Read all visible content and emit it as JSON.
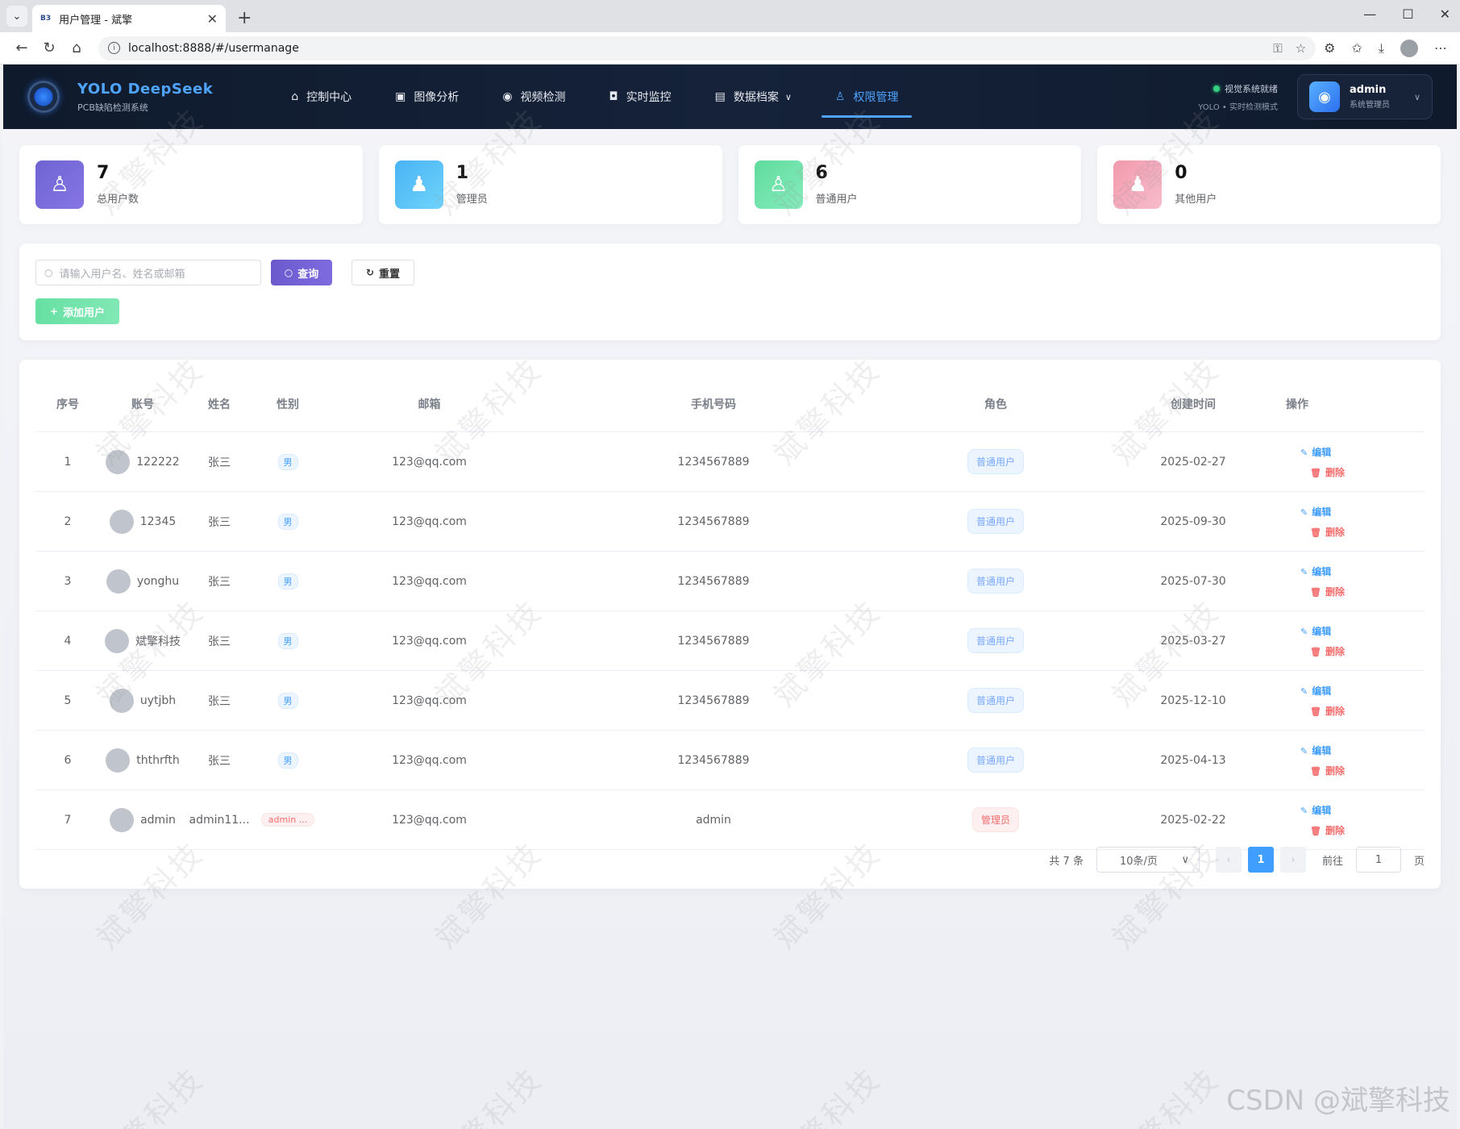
{
  "browser": {
    "tab_favicon": "B3",
    "tab_title": "用户管理 - 斌擎",
    "url": "localhost:8888/#/usermanage"
  },
  "header": {
    "brand_name": "YOLO DeepSeek",
    "brand_sub": "PCB缺陷检测系统",
    "nav": [
      {
        "label": "控制中心",
        "icon": "home-icon"
      },
      {
        "label": "图像分析",
        "icon": "image-icon"
      },
      {
        "label": "视频检测",
        "icon": "play-icon"
      },
      {
        "label": "实时监控",
        "icon": "camera-icon"
      },
      {
        "label": "数据档案",
        "icon": "document-icon"
      },
      {
        "label": "权限管理",
        "icon": "user-icon",
        "active": true
      }
    ],
    "status_text": "视觉系统就绪",
    "status_sub": "YOLO • 实时检测模式",
    "user_name": "admin",
    "user_role": "系统管理员"
  },
  "stats": [
    {
      "value": "7",
      "label": "总用户数",
      "color": "#7b6fd6"
    },
    {
      "value": "1",
      "label": "管理员",
      "color": "#4fc3f7"
    },
    {
      "value": "6",
      "label": "普通用户",
      "color": "#69e3a8"
    },
    {
      "value": "0",
      "label": "其他用户",
      "color": "#f4a7b5"
    }
  ],
  "search": {
    "placeholder": "请输入用户名、姓名或邮箱",
    "query_label": "查询",
    "reset_label": "重置",
    "add_label": "添加用户"
  },
  "table": {
    "headers": [
      "序号",
      "账号",
      "姓名",
      "性别",
      "邮箱",
      "手机号码",
      "角色",
      "创建时间",
      "操作"
    ],
    "edit_label": "编辑",
    "delete_label": "删除",
    "rows": [
      {
        "no": "1",
        "account": "122222",
        "name": "张三",
        "gender": "男",
        "email": "123@qq.com",
        "phone": "1234567889",
        "role": "普通用户",
        "created": "2025-02-27"
      },
      {
        "no": "2",
        "account": "12345",
        "name": "张三",
        "gender": "男",
        "email": "123@qq.com",
        "phone": "1234567889",
        "role": "普通用户",
        "created": "2025-09-30"
      },
      {
        "no": "3",
        "account": "yonghu",
        "name": "张三",
        "gender": "男",
        "email": "123@qq.com",
        "phone": "1234567889",
        "role": "普通用户",
        "created": "2025-07-30"
      },
      {
        "no": "4",
        "account": "斌擎科技",
        "name": "张三",
        "gender": "男",
        "email": "123@qq.com",
        "phone": "1234567889",
        "role": "普通用户",
        "created": "2025-03-27"
      },
      {
        "no": "5",
        "account": "uytjbh",
        "name": "张三",
        "gender": "男",
        "email": "123@qq.com",
        "phone": "1234567889",
        "role": "普通用户",
        "created": "2025-12-10"
      },
      {
        "no": "6",
        "account": "ththrfth",
        "name": "张三",
        "gender": "男",
        "email": "123@qq.com",
        "phone": "1234567889",
        "role": "普通用户",
        "created": "2025-04-13"
      },
      {
        "no": "7",
        "account": "admin",
        "name": "admin11...",
        "gender": "admin ...",
        "email": "123@qq.com",
        "phone": "admin",
        "role": "管理员",
        "created": "2025-02-22"
      }
    ]
  },
  "pagination": {
    "total": "共 7 条",
    "page_size": "10条/页",
    "current": "1",
    "goto_label": "前往",
    "goto_value": "1",
    "page_suffix": "页"
  },
  "watermark": {
    "text": "斌擎科技",
    "csdn": "CSDN @斌擎科技"
  }
}
